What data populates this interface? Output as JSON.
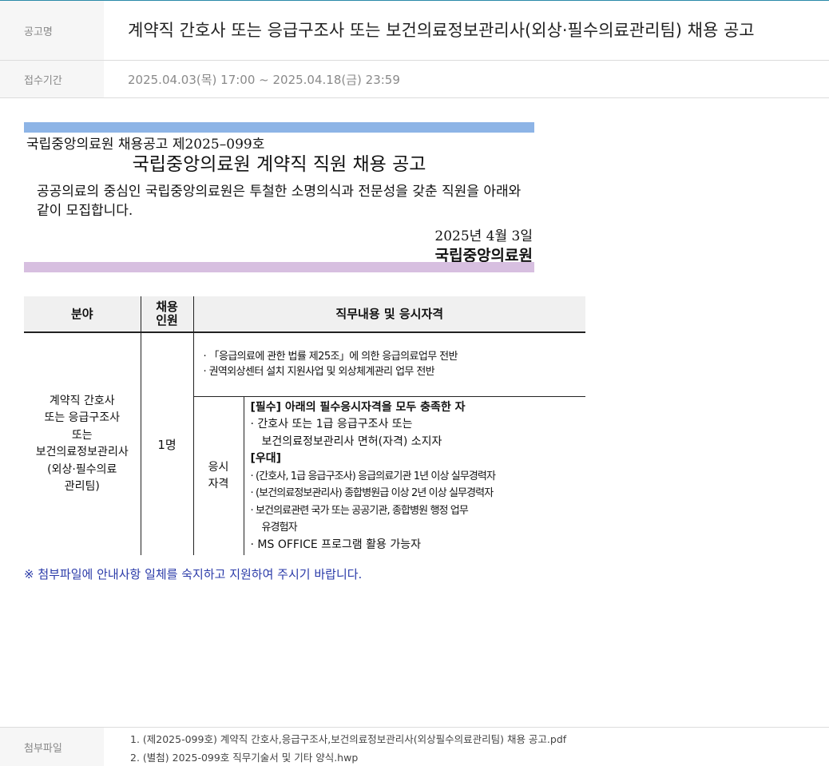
{
  "header": {
    "title_label": "공고명",
    "title_value": "계약직 간호사 또는 응급구조사 또는 보건의료정보관리사(외상·필수의료관리팀) 채용 공고",
    "period_label": "접수기간",
    "period_value": "2025.04.03(목) 17:00 ~ 2025.04.18(금) 23:59"
  },
  "notice": {
    "number": "국립중앙의료원 채용공고 제2025–099호",
    "heading": "국립중앙의료원 계약직 직원 채용 공고",
    "body": "공공의료의 중심인 국립중앙의료원은 투철한 소명의식과 전문성을 갖춘 직원을 아래와 같이 모집합니다.",
    "date": "2025년 4월 3일",
    "org": "국립중앙의료원",
    "bar_top_color": "#8db4e6",
    "bar_bottom_color": "#d7bfe0"
  },
  "table": {
    "headers": {
      "field": "분야",
      "count_line1": "채용",
      "count_line2": "인원",
      "duty": "직무내용 및 응시자격"
    },
    "field_lines": [
      "계약직 간호사",
      "또는 응급구조사",
      "또는",
      "보건의료정보관리사",
      "(외상·필수의료",
      "관리팀)"
    ],
    "count": "1명",
    "duties": [
      "·  「응급의료에 관한 법률 제25조」에 의한 응급의료업무 전반",
      "·  권역외상센터 설치 지원사업 및 외상체계관리 업무 전반"
    ],
    "qual_label_line1": "응시",
    "qual_label_line2": "자격",
    "qualifications": {
      "required_title": "[필수] 아래의 필수응시자격을 모두 충족한 자",
      "required_1": "· 간호사 또는 1급 응급구조사 또는",
      "required_2": "보건의료정보관리사 면허(자격) 소지자",
      "preferred_title": "[우대]",
      "preferred_1": "· (간호사, 1급 응급구조사) 응급의료기관 1년 이상 실무경력자",
      "preferred_2": "· (보건의료정보관리사) 종합병원급 이상 2년 이상 실무경력자",
      "preferred_3": "· 보건의료관련 국가 또는 공공기관, 종합병원 행정 업무",
      "preferred_3b": "유경험자",
      "preferred_4": "· MS OFFICE 프로그램 활용 가능자"
    }
  },
  "note": "※ 첨부파일에 안내사항 일체를 숙지하고 지원하여 주시기 바랍니다.",
  "attachments": {
    "label": "첨부파일",
    "items": [
      "1. (제2025-099호) 계약직 간호사,응급구조사,보건의료정보관리사(외상필수의료관리팀) 채용 공고.pdf",
      "2. (별첨) 2025-099호 직무기술서 및 기타 양식.hwp"
    ]
  },
  "colors": {
    "accent_rule": "#2a8aa8",
    "note_text": "#2a3aa8"
  }
}
